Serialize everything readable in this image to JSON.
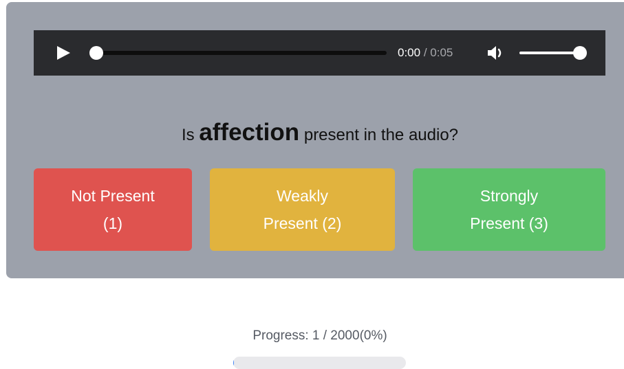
{
  "player": {
    "current_time": "0:00",
    "separator": "/",
    "duration": "0:05",
    "playback_fraction": 0,
    "volume_fraction": 1
  },
  "question": {
    "prefix": "Is",
    "keyword": "affection",
    "suffix": "present in the audio?"
  },
  "choices": [
    {
      "line1": "Not Present",
      "line2": "(1)",
      "color": "#df534f"
    },
    {
      "line1": "Weakly",
      "line2": "Present (2)",
      "color": "#e1b33e"
    },
    {
      "line1": "Strongly",
      "line2": "Present (3)",
      "color": "#5cc16a"
    }
  ],
  "progress": {
    "text": "Progress: 1 / 2000(0%)",
    "fraction": 0.0005
  },
  "colors": {
    "panel": "#9ca1ab",
    "player": "#2a2b2e"
  }
}
